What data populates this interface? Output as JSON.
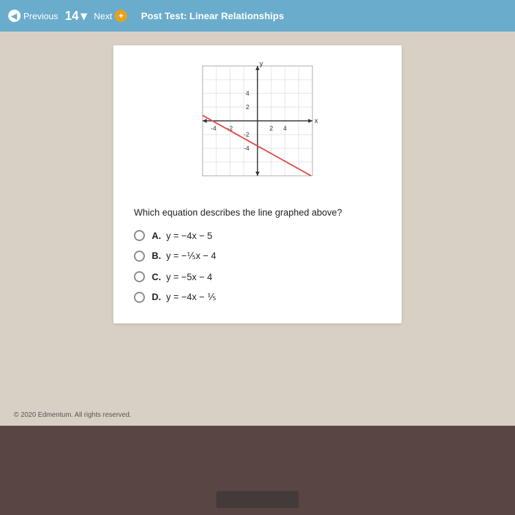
{
  "nav": {
    "prev_label": "Previous",
    "page_number": "14",
    "chevron": "▾",
    "next_label": "Next",
    "title": "Post Test: Linear Relationships"
  },
  "question": {
    "text": "Which equation describes the line graphed above?",
    "options": [
      {
        "id": "A",
        "label": "A.",
        "equation": "y = −4x − 5"
      },
      {
        "id": "B",
        "label": "B.",
        "equation": "y = −⅕x − 4"
      },
      {
        "id": "C",
        "label": "C.",
        "equation": "y = −5x − 4"
      },
      {
        "id": "D",
        "label": "D.",
        "equation": "y = −4x − ⅕"
      }
    ]
  },
  "footer": {
    "text": "© 2020 Edmentum. All rights reserved."
  },
  "graph": {
    "x_min": -4,
    "x_max": 4,
    "y_min": -4,
    "y_max": 4,
    "x_labels": [
      "-4",
      "-2",
      "2",
      "4"
    ],
    "y_labels": [
      "4",
      "2",
      "-2",
      "-4"
    ],
    "line_color": "#e05050"
  }
}
